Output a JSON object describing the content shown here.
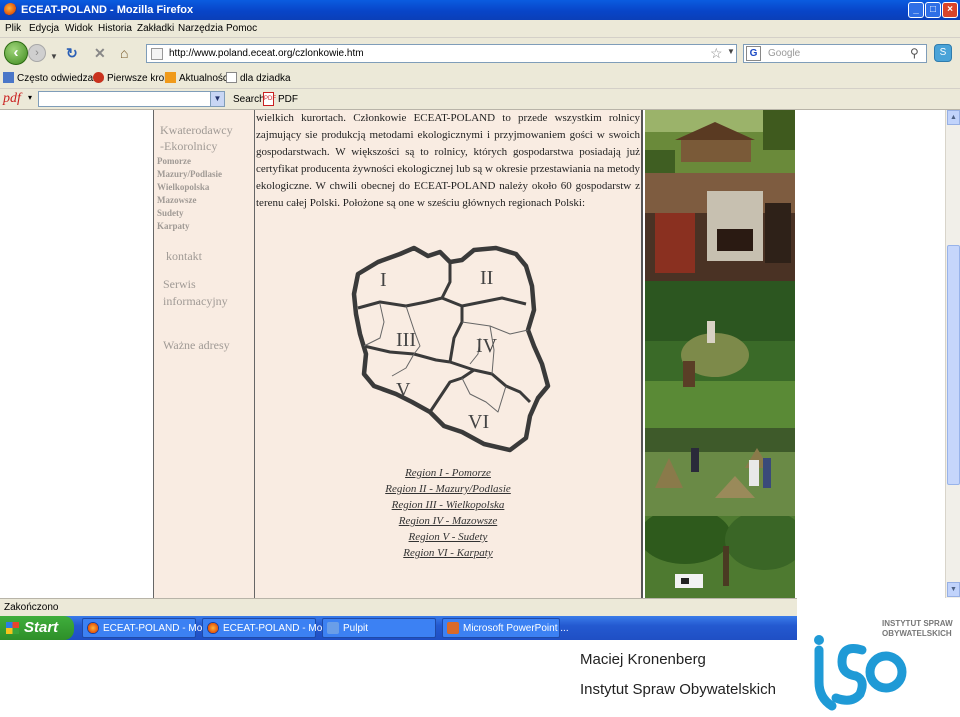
{
  "window": {
    "title": "ECEAT-POLAND - Mozilla Firefox",
    "min": "_",
    "max": "□",
    "close": "×"
  },
  "menu": [
    "Plik",
    "Edycja",
    "Widok",
    "Historia",
    "Zakładki",
    "Narzędzia",
    "Pomoc"
  ],
  "address": {
    "url": "http://www.poland.eceat.org/czlonkowie.htm",
    "search_placeholder": "Google"
  },
  "bookmarks": [
    "Często odwiedzane",
    "Pierwsze kroki",
    "Aktualności",
    "dla dziadka"
  ],
  "pdfbar": {
    "logo": "pdf",
    "search": "Search",
    "pdf": "PDF"
  },
  "sidebar": {
    "kwater1": "Kwaterodawcy",
    "kwater2": "-Ekorolnicy",
    "regions": [
      "Pomorze",
      "Mazury/Podlasie",
      "Wielkopolska",
      "Mazowsze",
      "Sudety",
      "Karpaty"
    ],
    "kontakt": "kontakt",
    "serwis1": "Serwis",
    "serwis2": "informacyjny",
    "adresy": "Ważne adresy"
  },
  "main": {
    "text": "wielkich kurortach. Członkowie ECEAT-POLAND to przede wszystkim rolnicy zajmujący sie produkcją metodami ekologicznymi i przyjmowaniem gości w swoich gospodarstwach. W większości są to rolnicy, których gospodarstwa posiadają już certyfikat producenta żywności ekologicznej lub są w okresie przestawiania na metody ekologiczne. W chwili obecnej do ECEAT-POLAND należy około 60 gospodarstw z terenu całej Polski. Położone są one w sześciu głównych regionach Polski:",
    "map_labels": [
      "I",
      "II",
      "III",
      "IV",
      "V",
      "VI"
    ],
    "region_links": [
      "Region I - Pomorze",
      "Region II - Mazury/Podlasie",
      "Region III - Wielkopolska",
      "Region IV - Mazowsze",
      "Region V - Sudety",
      "Region VI - Karpaty"
    ]
  },
  "status": "Zakończono",
  "taskbar": {
    "start": "Start",
    "tasks": [
      "ECEAT-POLAND - Mo...",
      "ECEAT-POLAND - Mo...",
      "Pulpit",
      "Microsoft PowerPoint ..."
    ]
  },
  "footer": {
    "author": "Maciej Kronenberg",
    "org": "Instytut Spraw Obywatelskich",
    "logo_line1": "INSTYTUT SPRAW",
    "logo_line2": "OBYWATELSKICH",
    "logo_mark": "iso"
  },
  "colors": {
    "page_bg": "#f9ece2",
    "title_blue": "#0a5ce0",
    "logo_blue": "#1f9ad6"
  }
}
